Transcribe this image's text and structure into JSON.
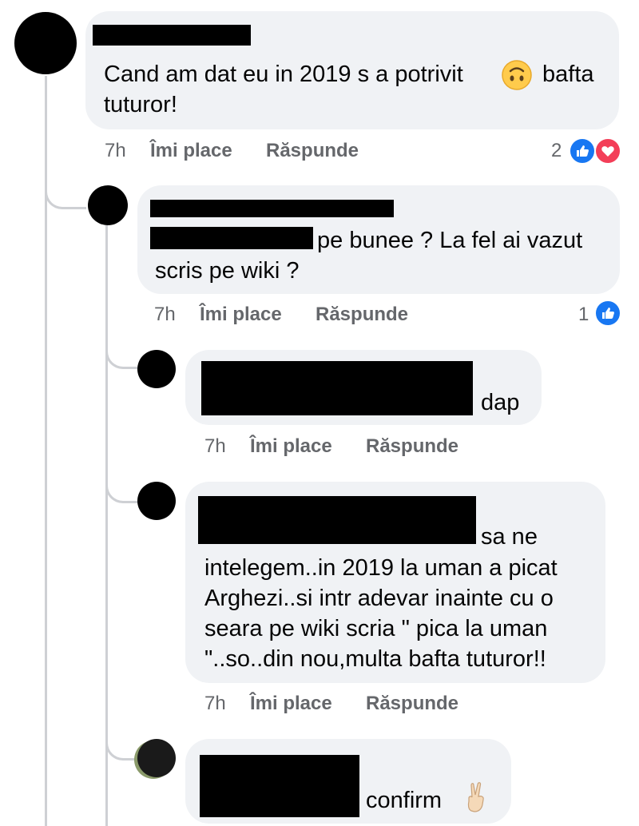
{
  "comments": [
    {
      "text_lines": [
        "Cand am dat eu in 2019 s a potrivit",
        "tuturor!"
      ],
      "text_after_emoji": "bafta",
      "emoji": "upside-down-face",
      "time": "7h",
      "like_label": "Îmi place",
      "reply_label": "Răspunde",
      "reaction_count": "2",
      "reactions": [
        "like",
        "love"
      ]
    },
    {
      "text_lines": [
        "pe bunee ? La fel ai vazut",
        "scris pe wiki ?"
      ],
      "time": "7h",
      "like_label": "Îmi place",
      "reply_label": "Răspunde",
      "reaction_count": "1",
      "reactions": [
        "like"
      ]
    },
    {
      "text_lines": [
        "dap"
      ],
      "time": "7h",
      "like_label": "Îmi place",
      "reply_label": "Răspunde"
    },
    {
      "text_lines": [
        "sa ne",
        "intelegem..in 2019 la uman a picat",
        "Arghezi..si intr adevar inainte cu o",
        "seara pe wiki scria \" pica la uman",
        "\"..so..din nou,multa bafta tuturor!!"
      ],
      "time": "7h",
      "like_label": "Îmi place",
      "reply_label": "Răspunde"
    },
    {
      "text_lines": [
        "confirm"
      ],
      "emoji": "victory-hand"
    }
  ],
  "colors": {
    "bubble": "#f0f2f5",
    "meta": "#65676b",
    "like": "#1877f2",
    "love": "#f33e58",
    "thread_line": "#ced0d4"
  }
}
